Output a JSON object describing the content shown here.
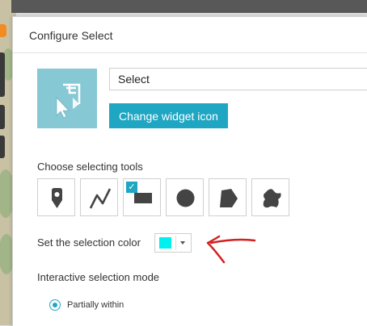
{
  "dialog": {
    "title": "Configure Select"
  },
  "widget": {
    "icon": "select-cursor-icon",
    "name_value": "Select",
    "change_icon_label": "Change widget icon"
  },
  "tools": {
    "label": "Choose selecting tools",
    "items": [
      {
        "icon": "point-icon",
        "selected": false
      },
      {
        "icon": "polyline-icon",
        "selected": false
      },
      {
        "icon": "rectangle-icon",
        "selected": true
      },
      {
        "icon": "circle-icon",
        "selected": false
      },
      {
        "icon": "polygon-icon",
        "selected": false
      },
      {
        "icon": "freehand-icon",
        "selected": false
      }
    ]
  },
  "selection_color": {
    "label": "Set the selection color",
    "value": "#00f0f0"
  },
  "mode": {
    "label": "Interactive selection mode",
    "option_label": "Partially within",
    "selected": true
  },
  "colors": {
    "accent": "#1fa6c2",
    "icon_box": "#86c8d4",
    "annotation_arrow": "#d42020"
  }
}
